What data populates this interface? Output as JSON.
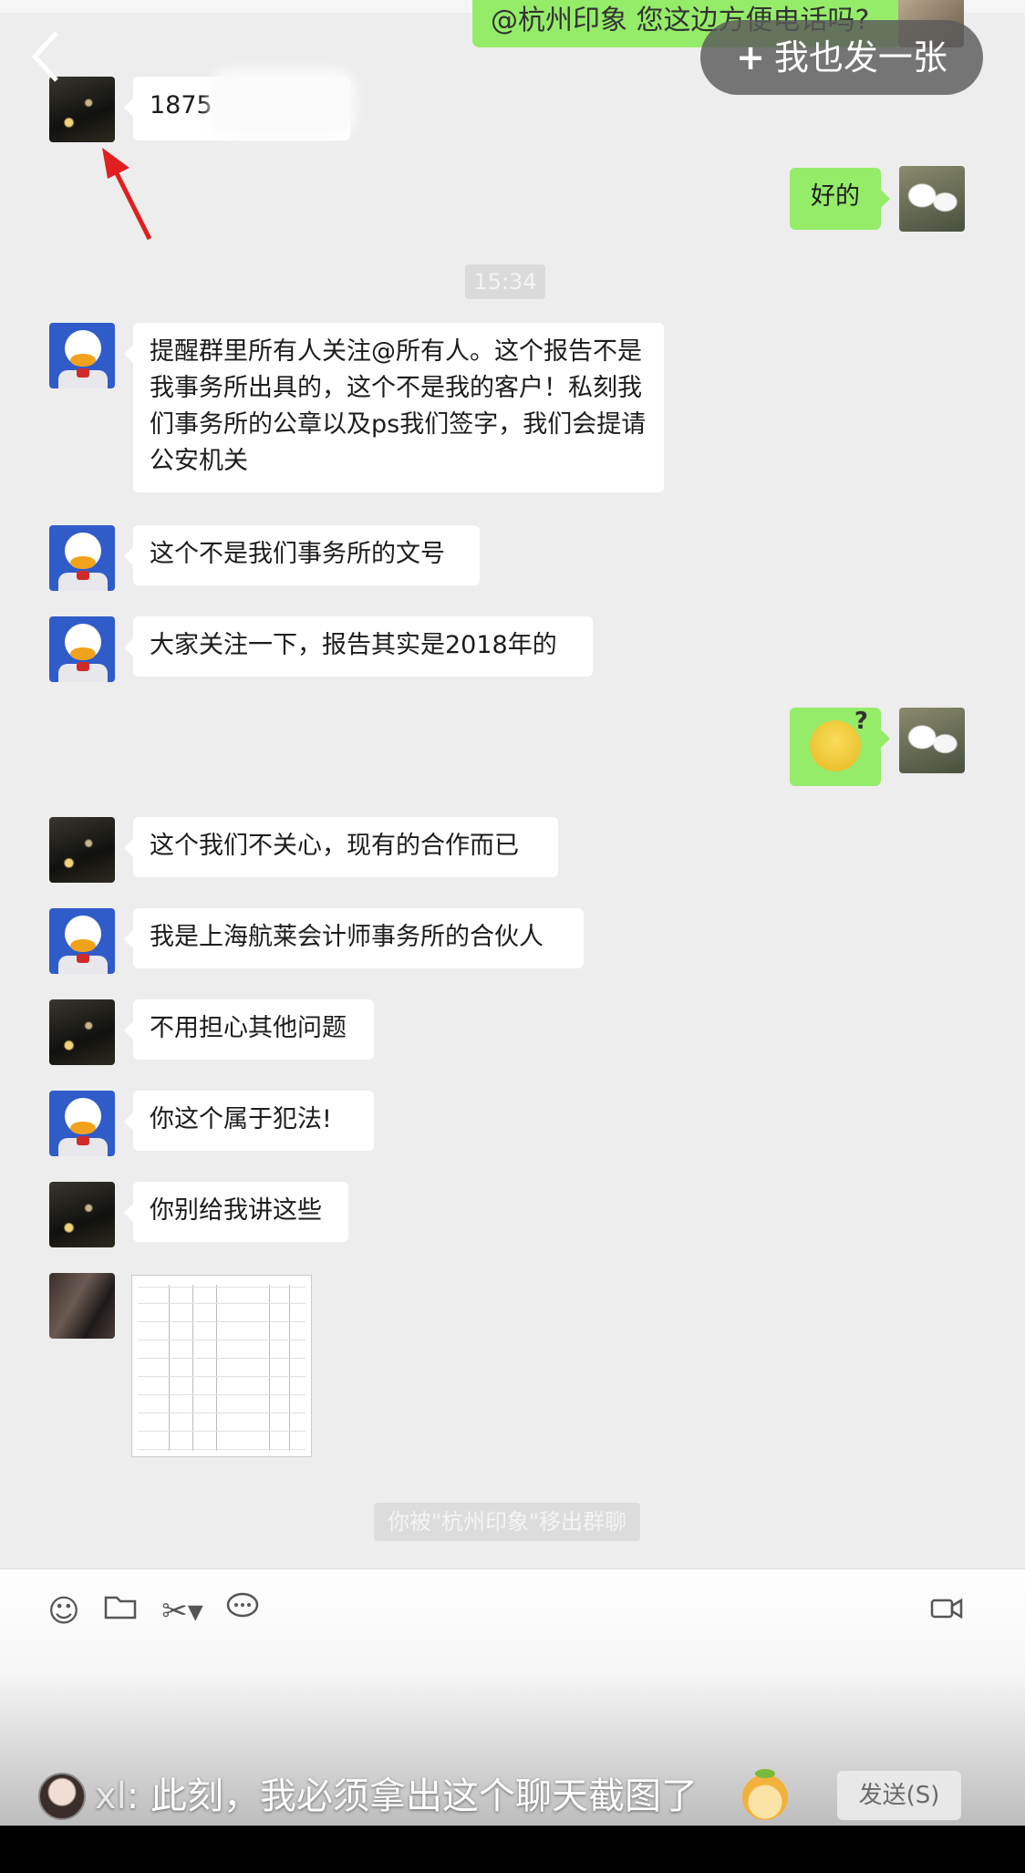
{
  "header": {
    "top_bubble_text": "@杭州印象 您这边方便电话吗?",
    "back_icon": "chevron-left-icon",
    "post_button": {
      "plus": "+",
      "label": "我也发一张"
    }
  },
  "messages": {
    "m1_text": "1875",
    "m2_text": "好的",
    "time_label": "15:34",
    "m3_text": "提醒群里所有人关注@所有人。这个报告不是我事务所出具的，这个不是我的客户！私刻我们事务所的公章以及ps我们签字，我们会提请公安机关",
    "m4_text": "这个不是我们事务所的文号",
    "m5_text": "大家关注一下，报告其实是2018年的",
    "m6_emoji": "confused-face-emoji",
    "m7_text": "这个我们不关心，现有的合作而已",
    "m8_text": "我是上海航莱会计师事务所的合伙人",
    "m9_text": "不用担心其他问题",
    "m10_text": "你这个属于犯法!",
    "m11_text": "你别给我讲这些",
    "m12_image": "financial-report-image",
    "system_notice": "你被\"杭州印象\"移出群聊"
  },
  "input_bar": {
    "icons": [
      "emoji-icon",
      "folder-icon",
      "scissors-icon",
      "chat-bubble-icon",
      "video-call-icon"
    ],
    "send_label": "发送(S)"
  },
  "comment": {
    "user": "xl",
    "separator": ": ",
    "text": "此刻，我必须拿出这个聊天截图了"
  },
  "colors": {
    "chat_bg": "#ededed",
    "my_bubble": "#95ec69",
    "other_bubble": "#ffffff",
    "arrow": "#e02020"
  }
}
